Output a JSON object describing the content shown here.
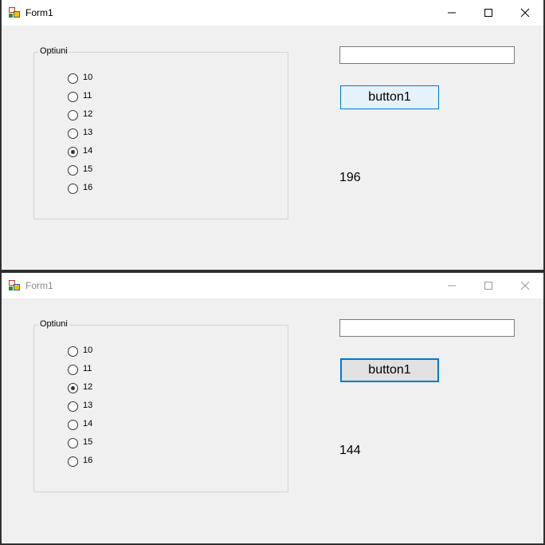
{
  "windows": [
    {
      "title": "Form1",
      "active": true,
      "groupbox_label": "Optiuni",
      "options": [
        "10",
        "11",
        "12",
        "13",
        "14",
        "15",
        "16"
      ],
      "selected": "14",
      "textbox_value": "",
      "button_label": "button1",
      "result": "196"
    },
    {
      "title": "Form1",
      "active": false,
      "groupbox_label": "Optiuni",
      "options": [
        "10",
        "11",
        "12",
        "13",
        "14",
        "15",
        "16"
      ],
      "selected": "12",
      "textbox_value": "",
      "button_label": "button1",
      "result": "144"
    }
  ],
  "icons": {
    "app": "winforms-app-icon",
    "minimize": "minimize-icon",
    "maximize": "maximize-icon",
    "close": "close-icon"
  },
  "colors": {
    "accent": "#0078d7",
    "form_background": "#f0f0f0",
    "titlebar": "#ffffff"
  }
}
